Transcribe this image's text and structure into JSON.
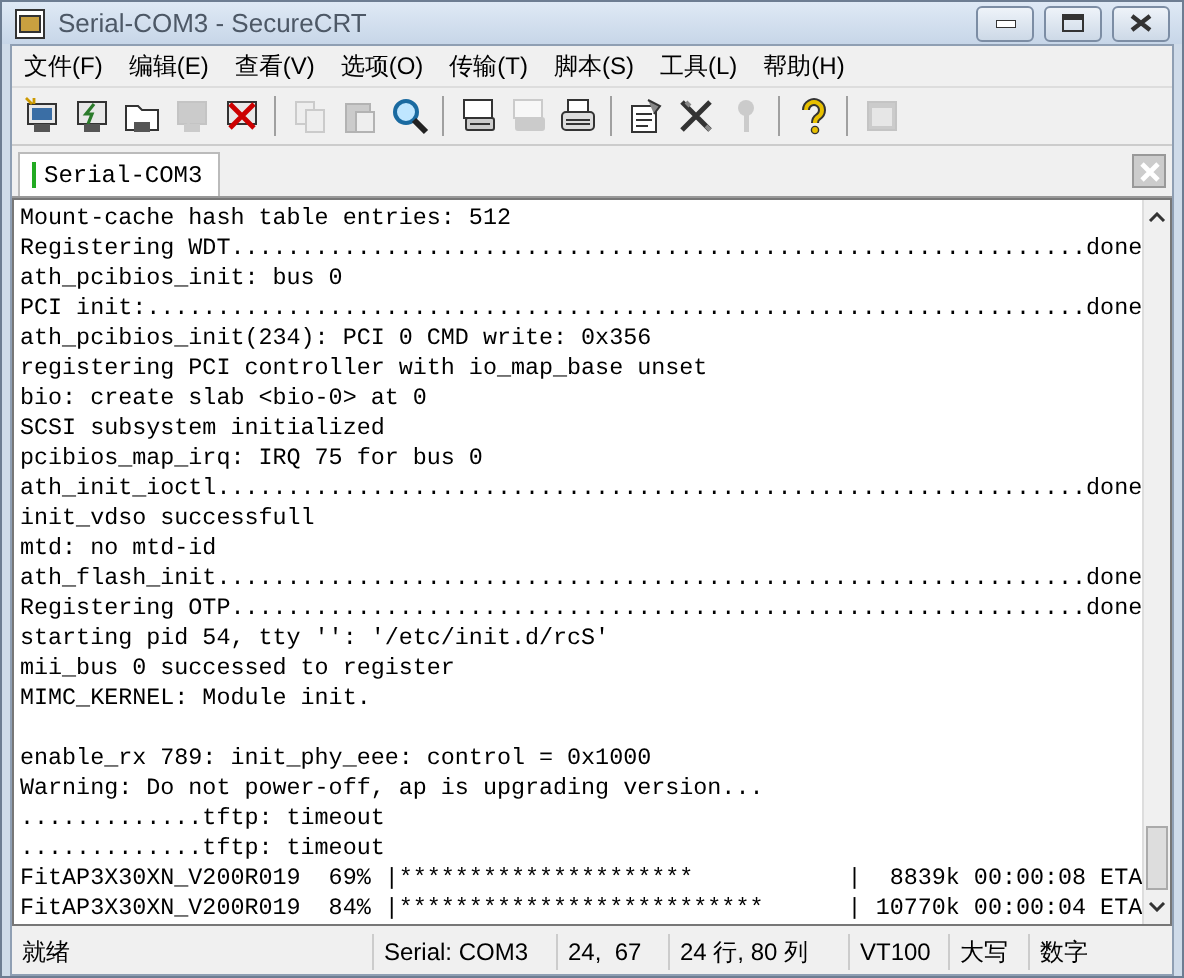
{
  "window": {
    "title": "Serial-COM3 - SecureCRT"
  },
  "menu": [
    "文件(F)",
    "编辑(E)",
    "查看(V)",
    "选项(O)",
    "传输(T)",
    "脚本(S)",
    "工具(L)",
    "帮助(H)"
  ],
  "toolbar": [
    {
      "kind": "monitor-new",
      "disabled": false
    },
    {
      "kind": "monitor-bolt",
      "disabled": false
    },
    {
      "kind": "folder",
      "disabled": false
    },
    {
      "kind": "monitor-bolt",
      "disabled": true
    },
    {
      "kind": "monitor-x",
      "disabled": false
    },
    {
      "kind": "separator"
    },
    {
      "kind": "copy",
      "disabled": true
    },
    {
      "kind": "paste",
      "disabled": true
    },
    {
      "kind": "search",
      "disabled": false
    },
    {
      "kind": "separator"
    },
    {
      "kind": "printer-screen",
      "disabled": false
    },
    {
      "kind": "printer-screen",
      "disabled": true
    },
    {
      "kind": "printer",
      "disabled": false
    },
    {
      "kind": "separator"
    },
    {
      "kind": "page",
      "disabled": false
    },
    {
      "kind": "tools",
      "disabled": false
    },
    {
      "kind": "key",
      "disabled": true
    },
    {
      "kind": "separator"
    },
    {
      "kind": "help",
      "disabled": false
    },
    {
      "kind": "separator"
    },
    {
      "kind": "window",
      "disabled": true
    }
  ],
  "tabs": [
    {
      "label": "Serial-COM3",
      "selected": true
    }
  ],
  "terminal": {
    "lines": [
      "Mount-cache hash table entries: 512",
      "Registering WDT.............................................................done",
      "ath_pcibios_init: bus 0",
      "PCI init:...................................................................done",
      "ath_pcibios_init(234): PCI 0 CMD write: 0x356",
      "registering PCI controller with io_map_base unset",
      "bio: create slab <bio-0> at 0",
      "SCSI subsystem initialized",
      "pcibios_map_irq: IRQ 75 for bus 0",
      "ath_init_ioctl..............................................................done",
      "init_vdso successfull",
      "mtd: no mtd-id",
      "ath_flash_init..............................................................done",
      "Registering OTP.............................................................done",
      "starting pid 54, tty '': '/etc/init.d/rcS'",
      "mii_bus 0 successed to register",
      "MIMC_KERNEL: Module init.",
      {
        "kind": "blank"
      },
      "enable_rx 789: init_phy_eee: control = 0x1000",
      "Warning: Do not power-off, ap is upgrading version...",
      ".............tftp: timeout",
      ".............tftp: timeout",
      "FitAP3X30XN_V200R019  69% |*********************           |  8839k 00:00:08 ETA",
      "FitAP3X30XN_V200R019  84% |**************************      | 10770k 00:00:04 ETA"
    ]
  },
  "status_bar": {
    "state": "就绪",
    "session": "Serial: COM3",
    "cursor": "24,  67",
    "size": "24 行, 80 列",
    "emulation": "VT100",
    "caps": "大写",
    "num": "数字"
  }
}
